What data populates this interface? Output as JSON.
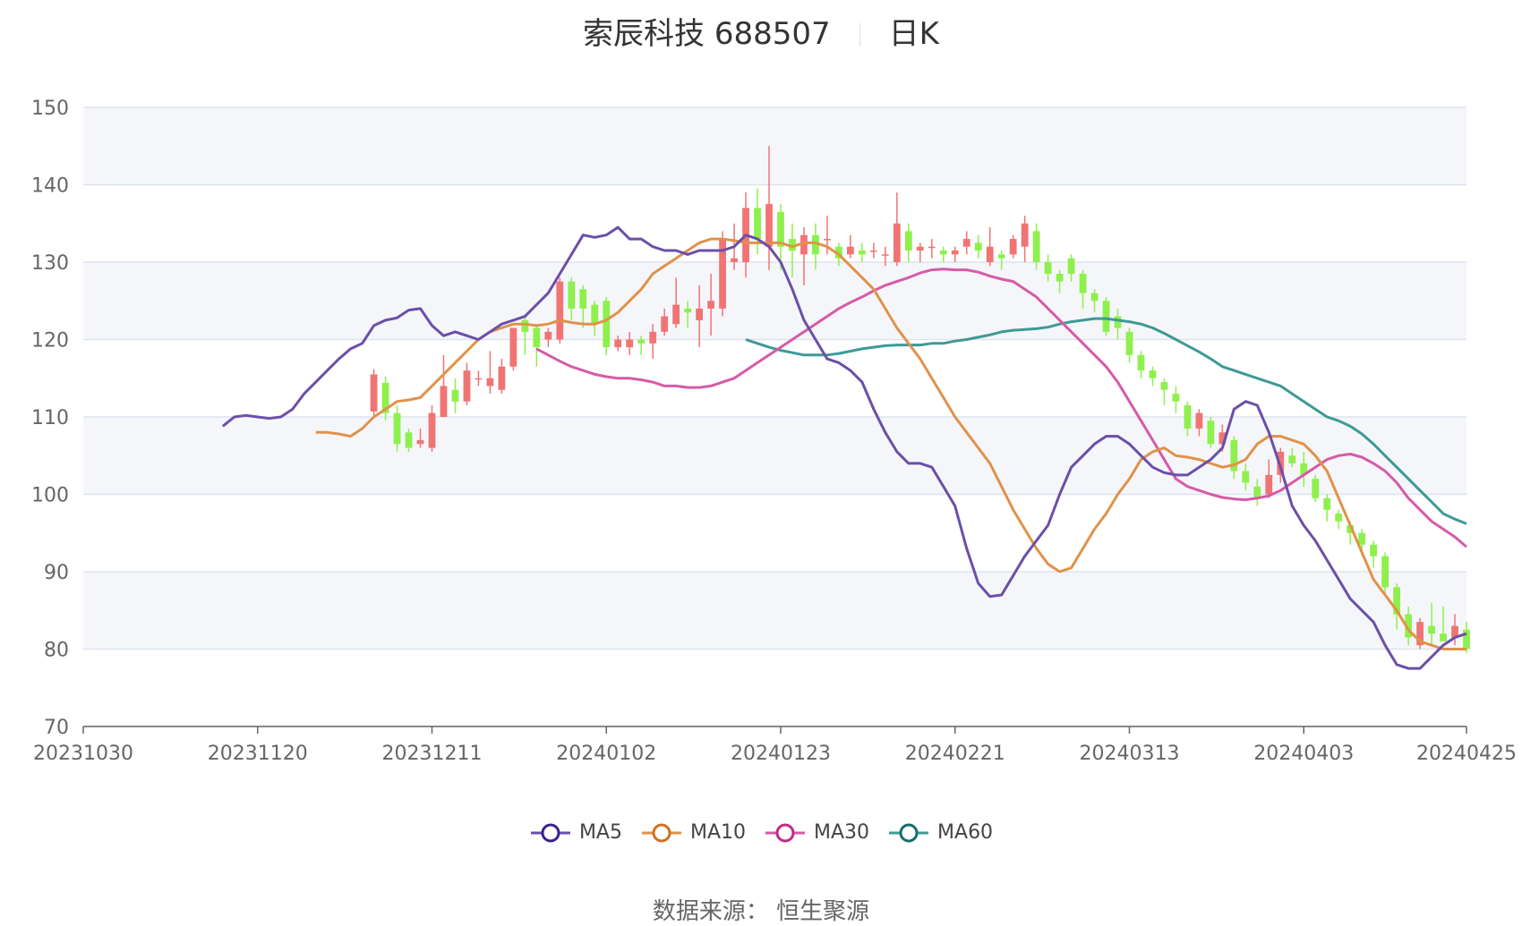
{
  "title": {
    "name": "索辰科技 688507",
    "period": "日K"
  },
  "source": "数据来源： 恒生聚源",
  "colors": {
    "up": "#f07474",
    "down": "#8ef04c",
    "grid": "#dde3ee",
    "band": "#f5f6fa",
    "axis": "#666666"
  },
  "chart_data": {
    "type": "candlestick",
    "ylim": [
      70,
      150
    ],
    "yticks": [
      70,
      80,
      90,
      100,
      110,
      120,
      130,
      140,
      150
    ],
    "x_tick_labels": [
      "20231030",
      "20231120",
      "20231211",
      "20240102",
      "20240123",
      "20240221",
      "20240313",
      "20240403",
      "20240425"
    ],
    "x_tick_positions": [
      0,
      15,
      30,
      45,
      60,
      75,
      90,
      105,
      119
    ],
    "legend": [
      {
        "name": "MA5",
        "color": "#6b4fa8",
        "stroke": "#3b1f8c"
      },
      {
        "name": "MA10",
        "color": "#e0924a",
        "stroke": "#d2701e"
      },
      {
        "name": "MA30",
        "color": "#d65aa8",
        "stroke": "#c4288a"
      },
      {
        "name": "MA60",
        "color": "#3d9a96",
        "stroke": "#166e6b"
      }
    ],
    "candles": [
      [
        110.7,
        115.5,
        116.2,
        110.0
      ],
      [
        114.4,
        110.5,
        115.2,
        109.5
      ],
      [
        110.5,
        106.5,
        111.5,
        105.5
      ],
      [
        108.0,
        106.0,
        108.5,
        105.5
      ],
      [
        106.5,
        107.0,
        108.5,
        106.0
      ],
      [
        106.0,
        110.5,
        111.5,
        105.5
      ],
      [
        110.0,
        114.0,
        118.0,
        110.0
      ],
      [
        113.5,
        112.0,
        115.0,
        110.5
      ],
      [
        112.0,
        116.0,
        117.0,
        111.5
      ],
      [
        115.0,
        115.0,
        116.0,
        114.0
      ],
      [
        114.0,
        115.0,
        118.5,
        113.0
      ],
      [
        113.5,
        116.5,
        117.5,
        113.0
      ],
      [
        116.5,
        121.5,
        121.5,
        116.0
      ],
      [
        122.5,
        121.0,
        123.0,
        118.0
      ],
      [
        121.5,
        119.0,
        122.0,
        116.5
      ],
      [
        120.0,
        121.0,
        121.5,
        119.0
      ],
      [
        120.0,
        127.5,
        128.0,
        119.5
      ],
      [
        127.5,
        124.0,
        128.0,
        122.5
      ],
      [
        126.5,
        124.0,
        127.0,
        121.5
      ],
      [
        124.5,
        122.0,
        125.0,
        120.5
      ],
      [
        125.0,
        119.0,
        125.5,
        118.0
      ],
      [
        119.0,
        120.0,
        120.5,
        118.5
      ],
      [
        119.0,
        120.0,
        121.0,
        118.0
      ],
      [
        120.0,
        119.5,
        120.5,
        118.0
      ],
      [
        119.5,
        121.0,
        122.0,
        117.5
      ],
      [
        121.0,
        123.0,
        124.0,
        120.5
      ],
      [
        122.0,
        124.5,
        128.0,
        121.5
      ],
      [
        124.0,
        123.5,
        125.0,
        121.5
      ],
      [
        122.5,
        124.0,
        127.0,
        119.0
      ],
      [
        124.0,
        125.0,
        128.5,
        120.5
      ],
      [
        124.0,
        133.0,
        134.0,
        123.0
      ],
      [
        130.0,
        130.5,
        135.0,
        129.0
      ],
      [
        130.0,
        137.0,
        139.0,
        128.0
      ],
      [
        137.0,
        133.0,
        139.5,
        131.0
      ],
      [
        132.0,
        137.5,
        145.0,
        129.0
      ],
      [
        136.5,
        132.0,
        137.5,
        129.0
      ],
      [
        133.0,
        131.5,
        135.0,
        128.0
      ],
      [
        131.0,
        133.5,
        134.5,
        127.0
      ],
      [
        133.5,
        131.0,
        135.0,
        129.0
      ],
      [
        133.0,
        133.0,
        136.0,
        131.0
      ],
      [
        132.0,
        130.5,
        132.5,
        129.5
      ],
      [
        131.0,
        132.0,
        133.5,
        130.5
      ],
      [
        131.5,
        131.0,
        132.5,
        130.0
      ],
      [
        131.5,
        131.5,
        132.5,
        130.5
      ],
      [
        131.0,
        131.0,
        132.0,
        129.5
      ],
      [
        130.0,
        135.0,
        139.0,
        129.5
      ],
      [
        134.0,
        131.5,
        135.0,
        130.0
      ],
      [
        131.5,
        132.0,
        132.5,
        130.0
      ],
      [
        132.0,
        132.0,
        133.0,
        130.5
      ],
      [
        131.5,
        131.0,
        132.0,
        130.0
      ],
      [
        131.0,
        131.5,
        132.0,
        130.0
      ],
      [
        132.0,
        133.0,
        134.0,
        131.0
      ],
      [
        132.5,
        131.5,
        133.5,
        130.5
      ],
      [
        130.0,
        132.0,
        134.5,
        129.5
      ],
      [
        131.0,
        130.5,
        131.5,
        129.0
      ],
      [
        131.0,
        133.0,
        133.5,
        130.5
      ],
      [
        132.0,
        135.0,
        136.0,
        130.0
      ],
      [
        134.0,
        130.0,
        135.0,
        129.0
      ],
      [
        130.0,
        128.5,
        131.0,
        127.5
      ],
      [
        128.5,
        127.5,
        129.0,
        126.0
      ],
      [
        130.5,
        128.5,
        131.0,
        127.5
      ],
      [
        128.5,
        126.0,
        129.0,
        124.0
      ],
      [
        126.0,
        125.0,
        126.5,
        123.5
      ],
      [
        125.0,
        121.0,
        125.5,
        120.5
      ],
      [
        123.0,
        121.5,
        124.0,
        120.0
      ],
      [
        121.0,
        118.0,
        121.5,
        117.0
      ],
      [
        118.0,
        116.0,
        118.5,
        115.0
      ],
      [
        116.0,
        115.0,
        116.5,
        114.0
      ],
      [
        114.5,
        113.5,
        115.0,
        111.5
      ],
      [
        113.0,
        112.0,
        114.0,
        110.5
      ],
      [
        111.5,
        108.5,
        112.0,
        107.5
      ],
      [
        108.5,
        110.5,
        111.0,
        107.5
      ],
      [
        109.5,
        106.5,
        110.0,
        106.0
      ],
      [
        106.5,
        108.0,
        109.0,
        105.5
      ],
      [
        107.0,
        103.0,
        107.5,
        102.0
      ],
      [
        103.0,
        101.5,
        104.0,
        100.5
      ],
      [
        101.0,
        99.5,
        102.0,
        98.5
      ],
      [
        100.0,
        102.5,
        104.5,
        99.5
      ],
      [
        102.5,
        105.5,
        106.0,
        101.5
      ],
      [
        105.0,
        104.0,
        106.0,
        103.5
      ],
      [
        104.0,
        102.5,
        105.5,
        101.0
      ],
      [
        102.0,
        99.5,
        102.5,
        99.0
      ],
      [
        99.5,
        98.0,
        100.0,
        96.5
      ],
      [
        97.5,
        96.5,
        98.0,
        95.5
      ],
      [
        96.0,
        95.0,
        96.5,
        93.5
      ],
      [
        95.0,
        93.5,
        95.5,
        92.0
      ],
      [
        93.5,
        92.0,
        94.0,
        90.5
      ],
      [
        92.0,
        88.0,
        92.5,
        87.0
      ],
      [
        88.0,
        84.5,
        88.5,
        82.5
      ],
      [
        84.5,
        81.5,
        85.5,
        80.5
      ],
      [
        80.5,
        83.5,
        84.0,
        80.0
      ],
      [
        83.0,
        82.0,
        86.0,
        80.5
      ],
      [
        82.0,
        81.0,
        85.5,
        81.5
      ],
      [
        81.5,
        83.0,
        84.5,
        80.5
      ],
      [
        82.5,
        80.0,
        83.5,
        79.5
      ]
    ],
    "ma5": [
      108.8,
      110.0,
      110.2,
      110.0,
      109.8,
      110.0,
      111.0,
      113.0,
      114.5,
      116.0,
      117.5,
      118.8,
      119.5,
      121.8,
      122.5,
      122.8,
      123.8,
      124.0,
      121.8,
      120.5,
      121.0,
      120.5,
      120.0,
      121.0,
      122.0,
      122.5,
      123.0,
      124.5,
      126.0,
      128.5,
      131.0,
      133.5,
      133.2,
      133.5,
      134.5,
      133.0,
      133.0,
      132.0,
      131.5,
      131.5,
      131.0,
      131.5,
      131.5,
      131.5,
      132.0,
      133.5,
      133.0,
      132.0,
      130.0,
      126.5,
      122.5,
      120.0,
      117.5,
      117.0,
      116.0,
      114.5,
      111.0,
      108.0,
      105.5,
      104.0,
      104.0,
      103.5,
      101.0,
      98.5,
      93.0,
      88.5,
      86.8,
      87.0,
      89.5,
      92.0,
      94.0,
      96.0,
      100.0,
      103.5,
      105.0,
      106.5,
      107.5,
      107.5,
      106.5,
      105.0,
      103.5,
      102.8,
      102.5,
      102.5,
      103.5,
      104.5,
      106.0,
      111.0,
      112.0,
      111.5,
      108.0,
      103.5,
      98.5,
      96.0,
      94.0,
      91.5,
      89.0,
      86.5,
      85.0,
      83.5,
      80.5,
      78.0,
      77.5,
      77.5,
      79.0,
      80.5,
      81.5,
      82.0
    ],
    "ma10": [
      108.0,
      108.0,
      107.8,
      107.5,
      108.5,
      110.0,
      111.0,
      112.0,
      112.2,
      112.5,
      114.0,
      115.5,
      117.0,
      118.5,
      120.0,
      121.0,
      121.5,
      122.0,
      122.0,
      121.8,
      122.0,
      122.5,
      122.2,
      122.0,
      122.0,
      122.5,
      123.5,
      125.0,
      126.5,
      128.5,
      129.5,
      130.5,
      131.5,
      132.5,
      133.0,
      133.0,
      132.8,
      132.5,
      132.5,
      132.5,
      132.5,
      132.0,
      132.5,
      132.5,
      132.0,
      131.0,
      129.5,
      128.0,
      126.5,
      124.0,
      121.5,
      119.5,
      117.5,
      115.0,
      112.5,
      110.0,
      108.0,
      106.0,
      104.0,
      101.0,
      98.0,
      95.5,
      93.0,
      91.0,
      90.0,
      90.5,
      93.0,
      95.5,
      97.5,
      100.0,
      102.0,
      104.5,
      105.5,
      106.0,
      105.0,
      104.8,
      104.5,
      104.0,
      103.5,
      103.8,
      104.5,
      106.5,
      107.5,
      107.5,
      107.0,
      106.5,
      105.0,
      103.0,
      99.5,
      96.0,
      92.5,
      89.0,
      87.0,
      85.0,
      82.5,
      81.0,
      80.5,
      80.0,
      80.0,
      80.0
    ],
    "ma30": [
      118.8,
      118.0,
      117.2,
      116.5,
      116.0,
      115.5,
      115.2,
      115.0,
      115.0,
      114.8,
      114.5,
      114.0,
      114.0,
      113.8,
      113.8,
      114.0,
      114.5,
      115.0,
      116.0,
      117.0,
      118.0,
      119.0,
      120.0,
      121.0,
      122.0,
      123.0,
      124.0,
      124.8,
      125.5,
      126.3,
      127.0,
      127.5,
      128.0,
      128.6,
      129.0,
      129.1,
      129.0,
      129.0,
      128.7,
      128.2,
      127.8,
      127.5,
      126.5,
      125.5,
      124.0,
      122.5,
      121.0,
      119.5,
      118.0,
      116.5,
      114.5,
      112.0,
      109.5,
      107.0,
      104.5,
      102.0,
      101.0,
      100.5,
      100.0,
      99.6,
      99.4,
      99.3,
      99.5,
      99.8,
      100.5,
      101.5,
      102.5,
      103.5,
      104.5,
      105.0,
      105.2,
      104.8,
      104.0,
      103.0,
      101.5,
      99.5,
      98.0,
      96.5,
      95.5,
      94.5,
      93.2
    ],
    "ma60": [
      120.0,
      119.5,
      119.0,
      118.6,
      118.3,
      118.0,
      118.0,
      118.0,
      118.2,
      118.5,
      118.8,
      119.0,
      119.2,
      119.3,
      119.3,
      119.3,
      119.5,
      119.5,
      119.8,
      120.0,
      120.3,
      120.6,
      121.0,
      121.2,
      121.3,
      121.4,
      121.6,
      122.0,
      122.3,
      122.5,
      122.7,
      122.7,
      122.5,
      122.3,
      122.0,
      121.5,
      120.8,
      120.0,
      119.2,
      118.4,
      117.5,
      116.5,
      116.0,
      115.5,
      115.0,
      114.5,
      114.0,
      113.0,
      112.0,
      111.0,
      110.0,
      109.5,
      108.8,
      107.8,
      106.5,
      105.0,
      103.5,
      102.0,
      100.5,
      99.0,
      97.5,
      96.8,
      96.2
    ]
  }
}
